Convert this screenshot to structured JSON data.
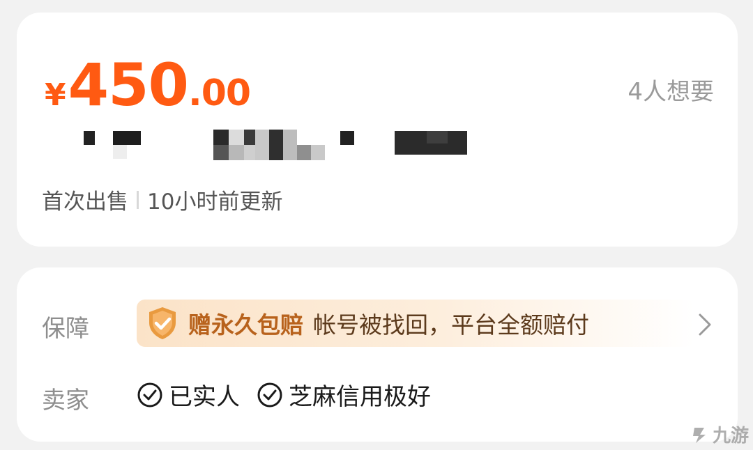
{
  "price": {
    "currency": "¥",
    "integer": "450",
    "decimal": ".00"
  },
  "want_count": "4人想要",
  "meta": {
    "condition": "首次出售",
    "updated": "10小时前更新"
  },
  "guarantee": {
    "label": "保障",
    "title": "赠永久包赔",
    "description": "帐号被找回，平台全额赔付"
  },
  "seller": {
    "label": "卖家",
    "tags": [
      "已实人",
      "芝麻信用极好"
    ]
  },
  "watermark": "九游",
  "colors": {
    "price": "#ff5a12",
    "guarantee_title": "#b8621c",
    "banner_bg": "#fbe3c8"
  }
}
